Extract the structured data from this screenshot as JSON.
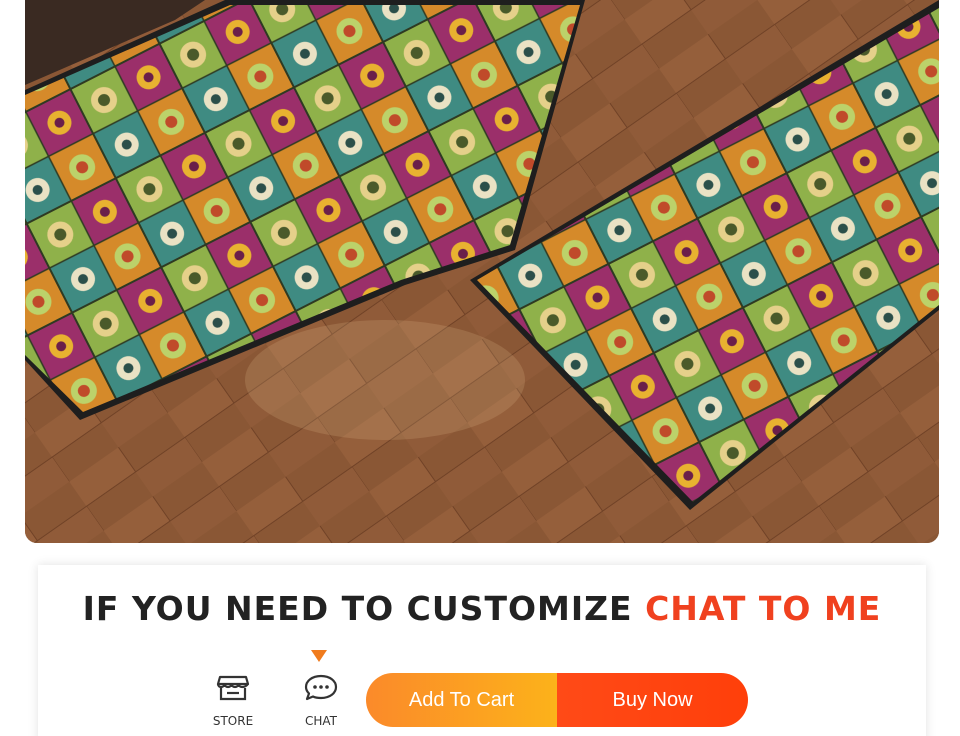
{
  "product_image": {
    "alt": "Patterned tile kitchen mats on wood floor"
  },
  "customize": {
    "headline_main": "IF YOU NEED TO CUSTOMIZE ",
    "headline_accent": "CHAT TO ME",
    "accent_color": "#f0411f"
  },
  "actions": {
    "store_label": "STORE",
    "chat_label": "CHAT",
    "add_to_cart_label": "Add To Cart",
    "buy_now_label": "Buy Now",
    "store_icon": "store-icon",
    "chat_icon": "chat-bubble-icon"
  },
  "colors": {
    "add_to_cart": "#fca12a",
    "buy_now": "#ff4612",
    "pointer": "#f07b1d"
  }
}
